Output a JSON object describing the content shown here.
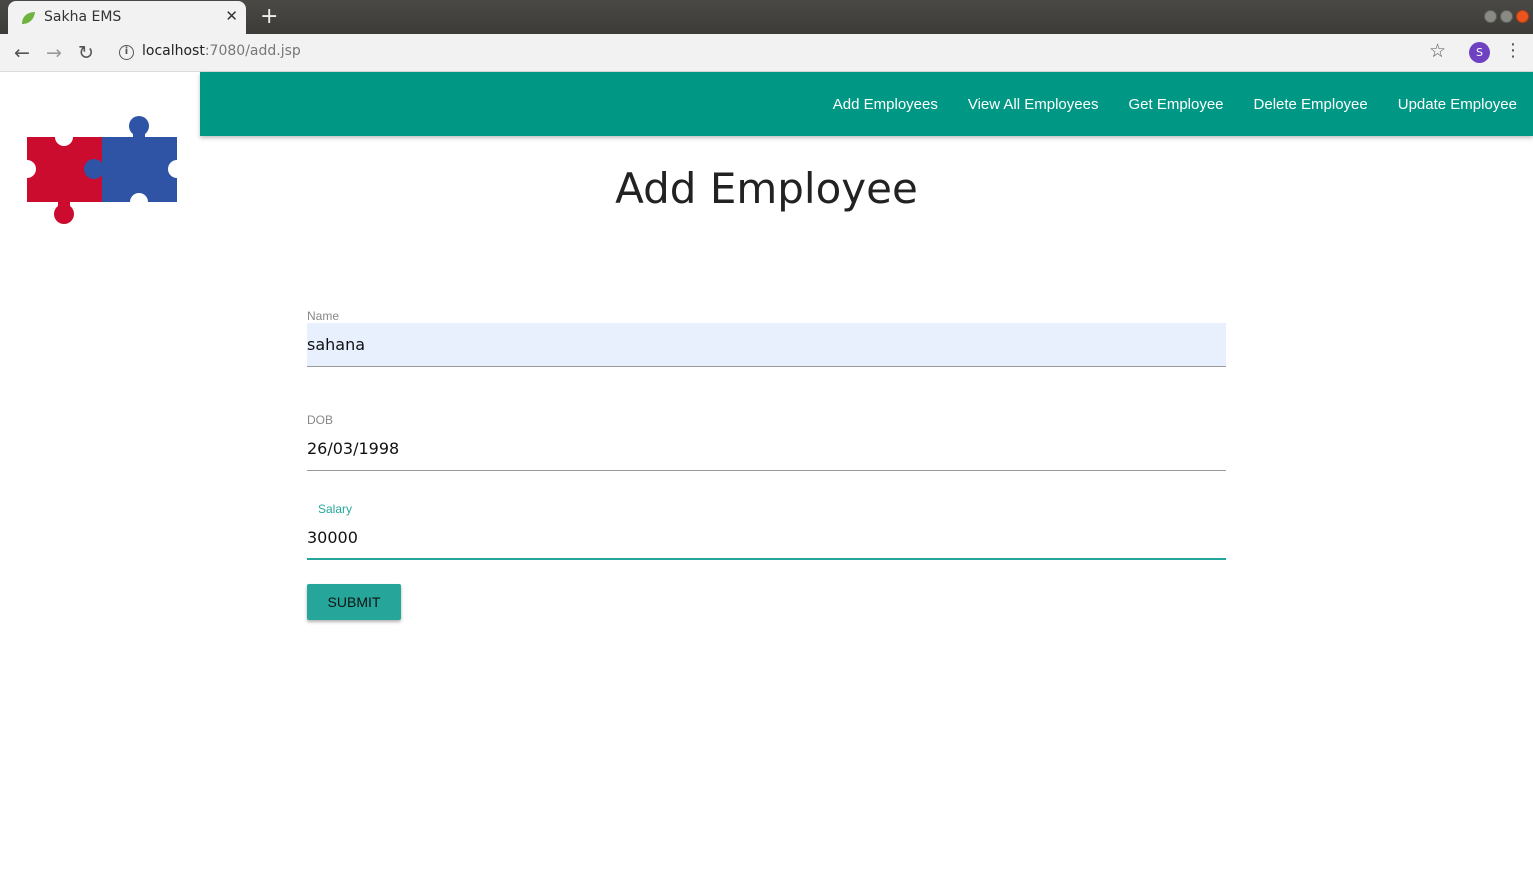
{
  "browser": {
    "tab_title": "Sakha EMS",
    "tab_close": "✕",
    "new_tab": "+",
    "url_host": "localhost",
    "url_path": ":7080/add.jsp",
    "profile_initial": "S"
  },
  "nav": {
    "links": [
      "Add Employees",
      "View All Employees",
      "Get Employee",
      "Delete Employee",
      "Update Employee"
    ],
    "bg_color": "#009885"
  },
  "page": {
    "title": "Add Employee"
  },
  "form": {
    "name": {
      "label": "Name",
      "value": "sahana"
    },
    "dob": {
      "label": "DOB",
      "value": "26/03/1998"
    },
    "salary": {
      "label": "Salary",
      "value": "30000"
    },
    "submit_label": "SUBMIT",
    "accent": "#26a69a"
  },
  "logo": {
    "icon": "puzzle-pieces-logo",
    "colors": [
      "#cc0c2e",
      "#2f53a5"
    ]
  }
}
